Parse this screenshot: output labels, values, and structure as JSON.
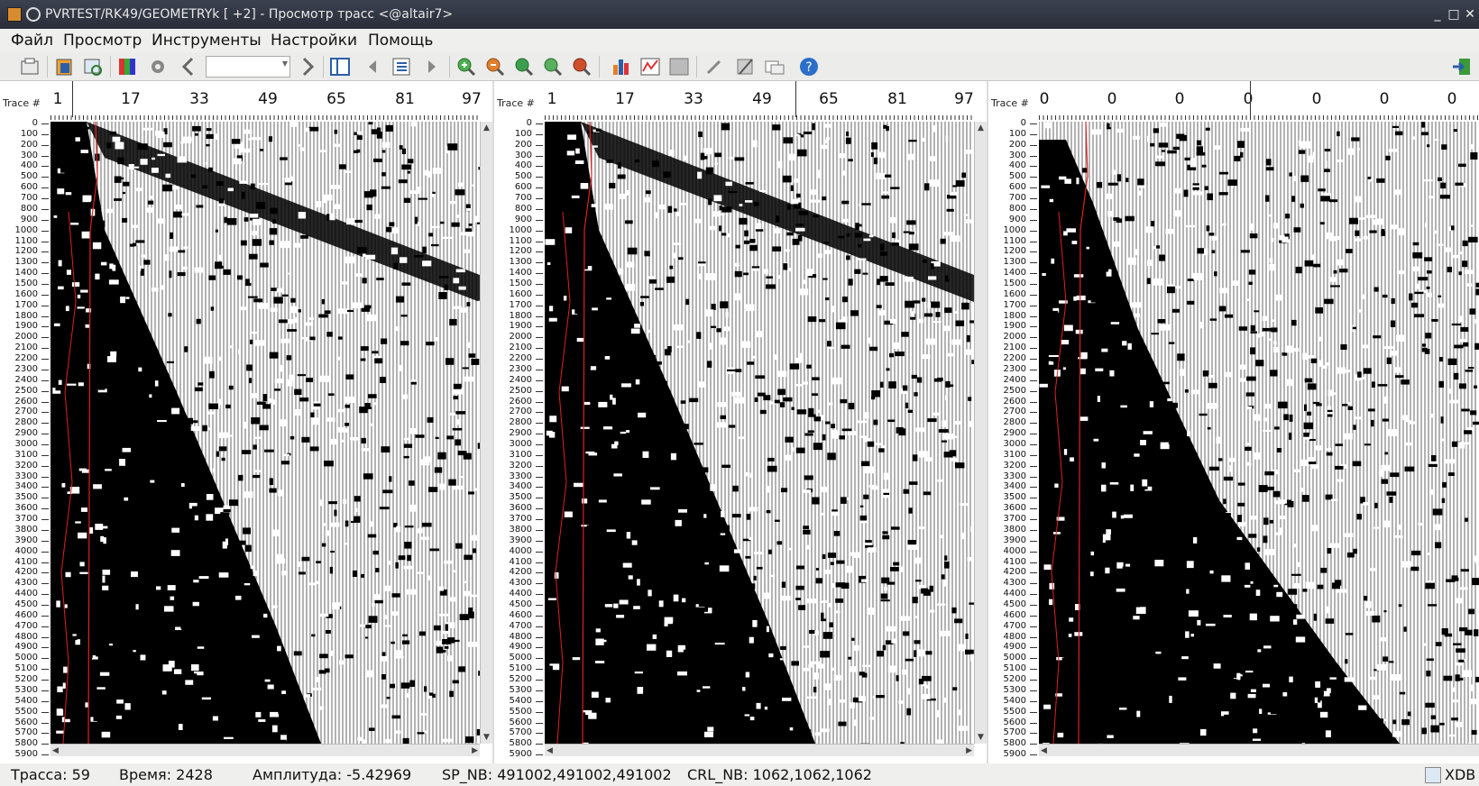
{
  "window": {
    "title": "PVRTEST/RK49/GEOMETRYk [ +2] - Просмотр трасс <@altair7>",
    "controls": [
      "_",
      "□",
      "✕"
    ]
  },
  "menu": [
    "Файл",
    "Просмотр",
    "Инструменты",
    "Настройки",
    "Помощь"
  ],
  "toolbar": {
    "combo_value": "",
    "icons": [
      "open-folder-icon",
      "properties-icon",
      "refresh-icon",
      "palette-icon",
      "settings-gear-icon",
      "prev-icon",
      "next-icon",
      "split-view-icon",
      "prev-ensemble-icon",
      "list-icon",
      "next-ensemble-icon",
      "zoom-in-icon",
      "zoom-out-icon",
      "zoom-fit-icon",
      "zoom-area-icon",
      "zoom-reset-icon",
      "histogram-icon",
      "spectrum-icon",
      "tiles-icon",
      "pick-icon",
      "edit-icon",
      "overlay-icon",
      "help-icon",
      "exit-icon"
    ]
  },
  "panels": [
    {
      "label": "Trace #",
      "numbers": [
        "1",
        "17",
        "33",
        "49",
        "65",
        "81",
        "97"
      ]
    },
    {
      "label": "Trace #",
      "numbers": [
        "1",
        "17",
        "33",
        "49",
        "65",
        "81",
        "97"
      ]
    },
    {
      "label": "Trace #",
      "numbers": [
        "0",
        "0",
        "0",
        "0",
        "0",
        "0",
        "0"
      ]
    }
  ],
  "time_labels": [
    "0",
    "100",
    "200",
    "300",
    "400",
    "500",
    "600",
    "700",
    "800",
    "900",
    "1000",
    "1100",
    "1200",
    "1300",
    "1400",
    "1500",
    "1600",
    "1700",
    "1800",
    "1900",
    "2000",
    "2100",
    "2200",
    "2300",
    "2400",
    "2500",
    "2600",
    "2700",
    "2800",
    "2900",
    "3000",
    "3100",
    "3200",
    "3300",
    "3400",
    "3500",
    "3600",
    "3700",
    "3800",
    "3900",
    "4000",
    "4100",
    "4200",
    "4300",
    "4400",
    "4500",
    "4600",
    "4700",
    "4800",
    "4900",
    "5000",
    "5100",
    "5200",
    "5300",
    "5400",
    "5500",
    "5600",
    "5700",
    "5800",
    "5900"
  ],
  "status": {
    "trace": "Трасса: 59",
    "time": "Время: 2428",
    "amplitude": "Амплитуда: -5.42969",
    "sp": "SP_NB: 491002,491002,491002",
    "crl": "CRL_NB: 1062,1062,1062",
    "xdb": "XDB"
  }
}
